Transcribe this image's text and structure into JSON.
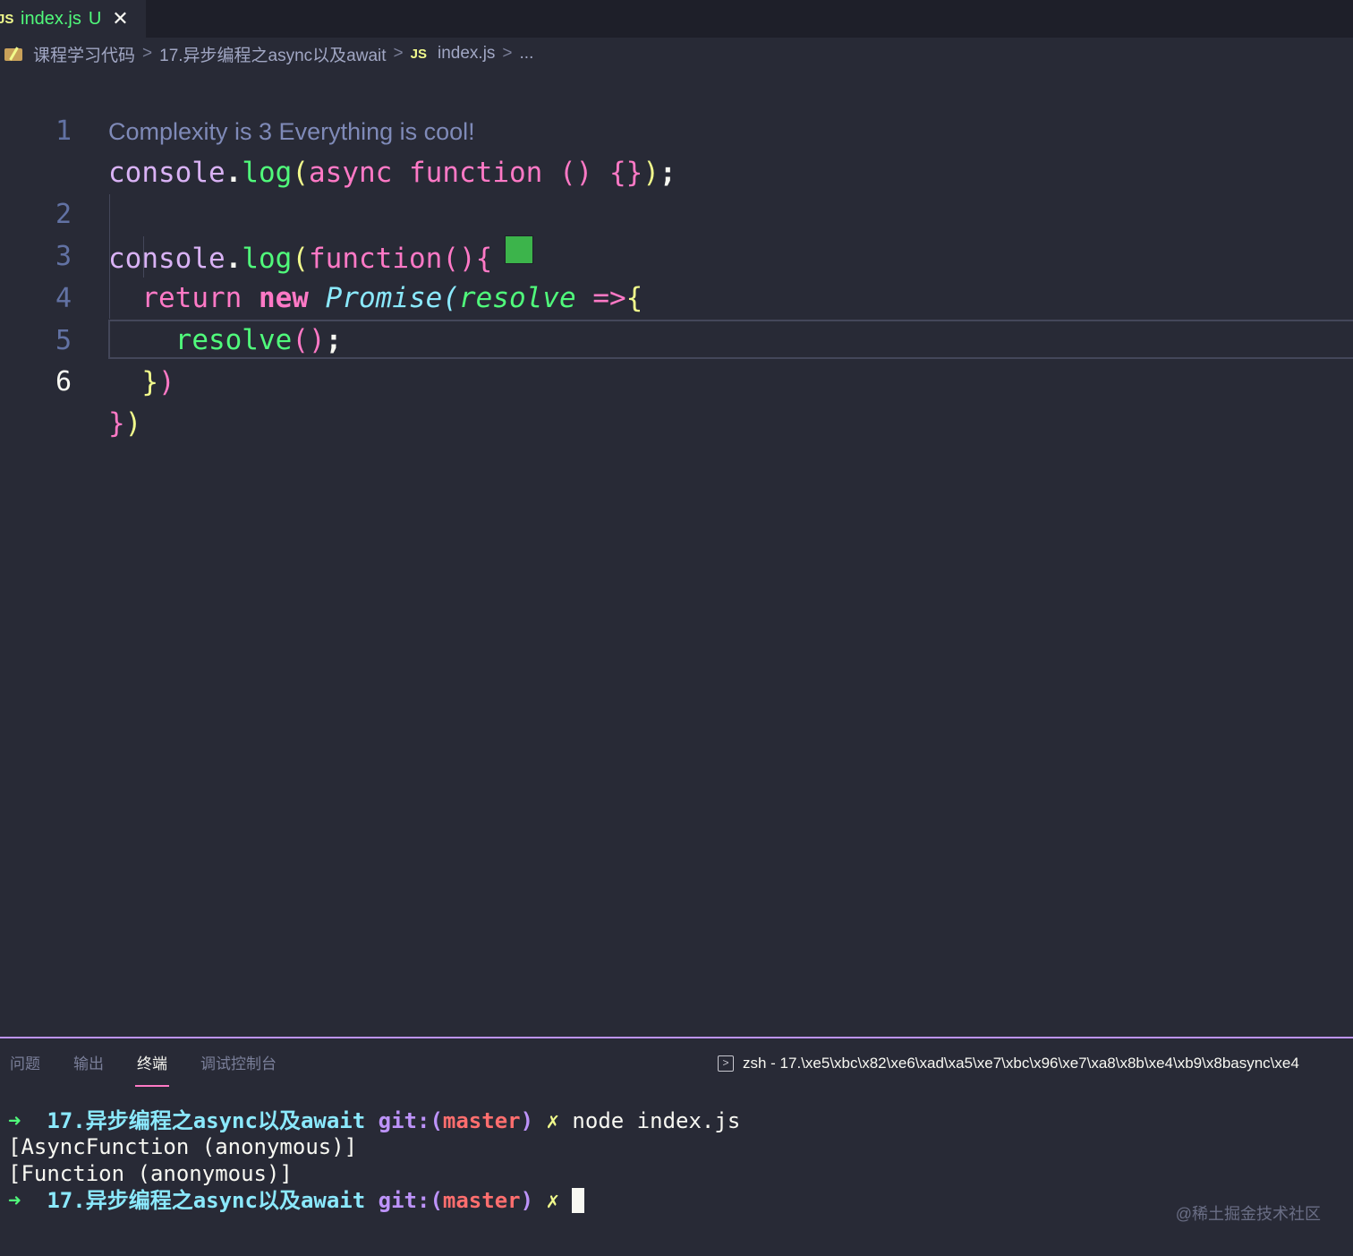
{
  "tab": {
    "lang_badge": "JS",
    "filename": "index.js",
    "status": "U",
    "close_glyph": "✕"
  },
  "breadcrumb": {
    "root": "课程学习代码",
    "folder": "17.异步编程之async以及await",
    "file_badge": "JS",
    "file": "index.js",
    "ellipsis": "..."
  },
  "editor": {
    "complexity_hint": "Complexity is 3 Everything is cool!",
    "lines": [
      {
        "no": "1"
      },
      {
        "no": "2"
      },
      {
        "no": "3"
      },
      {
        "no": "4"
      },
      {
        "no": "5"
      },
      {
        "no": "6"
      }
    ],
    "swatch_color": "#3cb44b"
  },
  "panel": {
    "tabs": [
      "问题",
      "输出",
      "终端",
      "调试控制台"
    ],
    "active_tab": "终端",
    "terminal_title": "zsh - 17.\\xe5\\xbc\\x82\\xe6\\xad\\xa5\\xe7\\xbc\\x96\\xe7\\xa8\\x8b\\xe4\\xb9\\x8basync\\xe4"
  },
  "terminal": {
    "prompt_arrow": "➜",
    "dir": "17.异步编程之async以及await",
    "git_label": "git:(",
    "branch": "master",
    "git_close": ")",
    "dirty": "✗",
    "command": "node index.js",
    "output": [
      "[AsyncFunction (anonymous)]",
      "[Function (anonymous)]"
    ]
  },
  "watermark": "@稀土掘金技术社区"
}
